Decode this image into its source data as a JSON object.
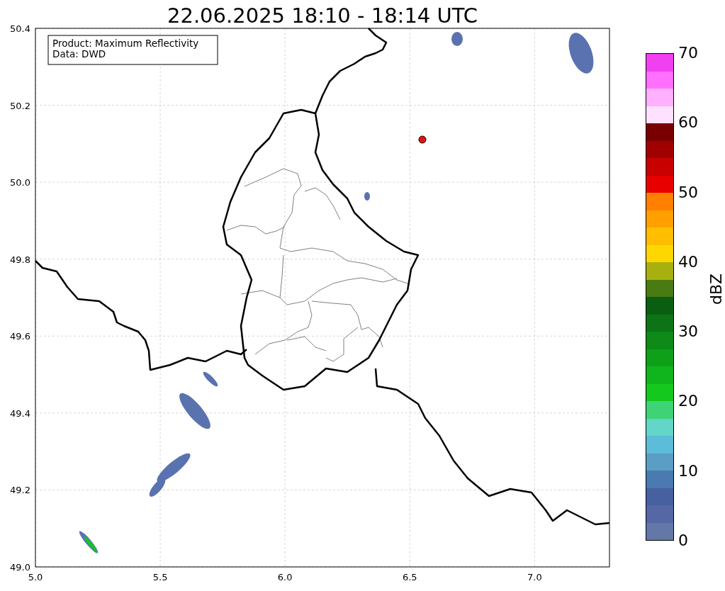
{
  "title": "22.06.2025 18:10 - 18:14 UTC",
  "legend": [
    "Product: Maximum Reflectivity",
    "Data: DWD"
  ],
  "x_ticks": [
    "5.0",
    "5.5",
    "6.0",
    "6.5",
    "7.0"
  ],
  "y_ticks": [
    "50.4",
    "50.2",
    "50.0",
    "49.8",
    "49.6",
    "49.4",
    "49.2",
    "49.0"
  ],
  "colorbar": {
    "label": "dBZ",
    "ticks": [
      "70",
      "60",
      "50",
      "40",
      "30",
      "20",
      "10",
      "0"
    ],
    "bands": [
      {
        "color": "#f040f0"
      },
      {
        "color": "#ff70ff"
      },
      {
        "color": "#ffb0ff"
      },
      {
        "color": "#ffe0ff"
      },
      {
        "color": "#7a0000"
      },
      {
        "color": "#a00000"
      },
      {
        "color": "#c80000"
      },
      {
        "color": "#e80000"
      },
      {
        "color": "#ff7f00"
      },
      {
        "color": "#ffa000"
      },
      {
        "color": "#ffbe00"
      },
      {
        "color": "#ffd700"
      },
      {
        "color": "#a8b010"
      },
      {
        "color": "#4a7a12"
      },
      {
        "color": "#0a5e12"
      },
      {
        "color": "#0c7416"
      },
      {
        "color": "#0d8a18"
      },
      {
        "color": "#0fa01a"
      },
      {
        "color": "#10b41c"
      },
      {
        "color": "#14c81e"
      },
      {
        "color": "#3ed475"
      },
      {
        "color": "#62d6c8"
      },
      {
        "color": "#5dbcd8"
      },
      {
        "color": "#5a9dc5"
      },
      {
        "color": "#4a7ab0"
      },
      {
        "color": "#4660a0"
      },
      {
        "color": "#5567a5"
      },
      {
        "color": "#6478a8"
      }
    ]
  }
}
